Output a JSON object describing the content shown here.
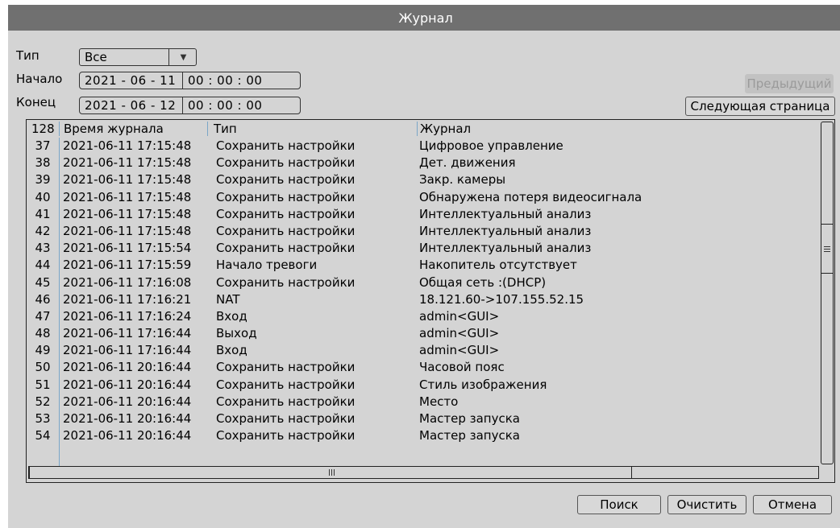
{
  "window": {
    "title": "Журнал"
  },
  "filters": {
    "type_label": "Тип",
    "type_value": "Все",
    "start_label": "Начало",
    "start_date": "2021 - 06 - 11",
    "start_time": "00 : 00 : 00",
    "end_label": "Конец",
    "end_date": "2021 - 06 - 12",
    "end_time": "00 : 00 : 00"
  },
  "paging": {
    "prev_label": "Предыдущий",
    "next_label": "Следующая страница"
  },
  "table": {
    "count": "128",
    "headers": {
      "time": "Время журнала",
      "type": "Тип",
      "log": "Журнал"
    },
    "rows": [
      {
        "num": "37",
        "time": "2021-06-11 17:15:48",
        "type": "Сохранить настройки",
        "log": "Цифровое управление"
      },
      {
        "num": "38",
        "time": "2021-06-11 17:15:48",
        "type": "Сохранить настройки",
        "log": "Дет. движения"
      },
      {
        "num": "39",
        "time": "2021-06-11 17:15:48",
        "type": "Сохранить настройки",
        "log": "Закр. камеры"
      },
      {
        "num": "40",
        "time": "2021-06-11 17:15:48",
        "type": "Сохранить настройки",
        "log": "Обнаружена потеря видеосигнала"
      },
      {
        "num": "41",
        "time": "2021-06-11 17:15:48",
        "type": "Сохранить настройки",
        "log": "Интеллектуальный анализ"
      },
      {
        "num": "42",
        "time": "2021-06-11 17:15:48",
        "type": "Сохранить настройки",
        "log": "Интеллектуальный анализ"
      },
      {
        "num": "43",
        "time": "2021-06-11 17:15:54",
        "type": "Сохранить настройки",
        "log": "Интеллектуальный анализ"
      },
      {
        "num": "44",
        "time": "2021-06-11 17:15:59",
        "type": "Начало тревоги",
        "log": "Накопитель отсутствует"
      },
      {
        "num": "45",
        "time": "2021-06-11 17:16:08",
        "type": "Сохранить настройки",
        "log": "Общая сеть :(DHCP)"
      },
      {
        "num": "46",
        "time": "2021-06-11 17:16:21",
        "type": "NAT",
        "log": "18.121.60->107.155.52.15"
      },
      {
        "num": "47",
        "time": "2021-06-11 17:16:24",
        "type": "Вход",
        "log": "admin<GUI>"
      },
      {
        "num": "48",
        "time": "2021-06-11 17:16:44",
        "type": "Выход",
        "log": "admin<GUI>"
      },
      {
        "num": "49",
        "time": "2021-06-11 17:16:44",
        "type": "Вход",
        "log": "admin<GUI>"
      },
      {
        "num": "50",
        "time": "2021-06-11 20:16:44",
        "type": "Сохранить настройки",
        "log": "Часовой пояс"
      },
      {
        "num": "51",
        "time": "2021-06-11 20:16:44",
        "type": "Сохранить настройки",
        "log": "Стиль изображения"
      },
      {
        "num": "52",
        "time": "2021-06-11 20:16:44",
        "type": "Сохранить настройки",
        "log": "Место"
      },
      {
        "num": "53",
        "time": "2021-06-11 20:16:44",
        "type": "Сохранить настройки",
        "log": "Мастер запуска"
      },
      {
        "num": "54",
        "time": "2021-06-11 20:16:44",
        "type": "Сохранить настройки",
        "log": "Мастер запуска"
      }
    ]
  },
  "actions": {
    "search_label": "Поиск",
    "clear_label": "Очистить",
    "cancel_label": "Отмена"
  }
}
